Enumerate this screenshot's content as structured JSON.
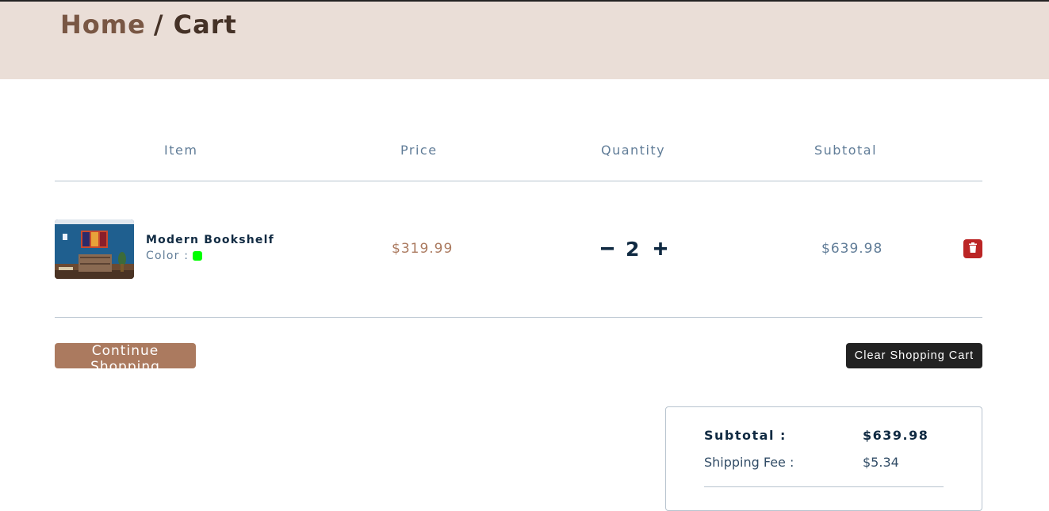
{
  "breadcrumb": {
    "home": "Home",
    "current": "/ Cart"
  },
  "columns": {
    "item": "Item",
    "price": "Price",
    "quantity": "Quantity",
    "subtotal": "Subtotal"
  },
  "cart_items": [
    {
      "name": "Modern Bookshelf",
      "color_label": "Color :",
      "color": "#00ff00",
      "price": "$319.99",
      "quantity": "2",
      "subtotal": "$639.98"
    }
  ],
  "actions": {
    "continue": "Continue Shopping",
    "clear": "Clear Shopping Cart"
  },
  "totals": {
    "subtotal_label": "Subtotal :",
    "subtotal_value": "$639.98",
    "shipping_label": "Shipping Fee :",
    "shipping_value": "$5.34"
  },
  "colors": {
    "accent": "#ab7a5f",
    "hero_bg": "#eaded7",
    "danger": "#bb2525",
    "dark": "#222222",
    "heading": "#102a42",
    "muted": "#617d98"
  },
  "icons": {
    "decrease": "minus-icon",
    "increase": "plus-icon",
    "remove": "trash-icon"
  }
}
